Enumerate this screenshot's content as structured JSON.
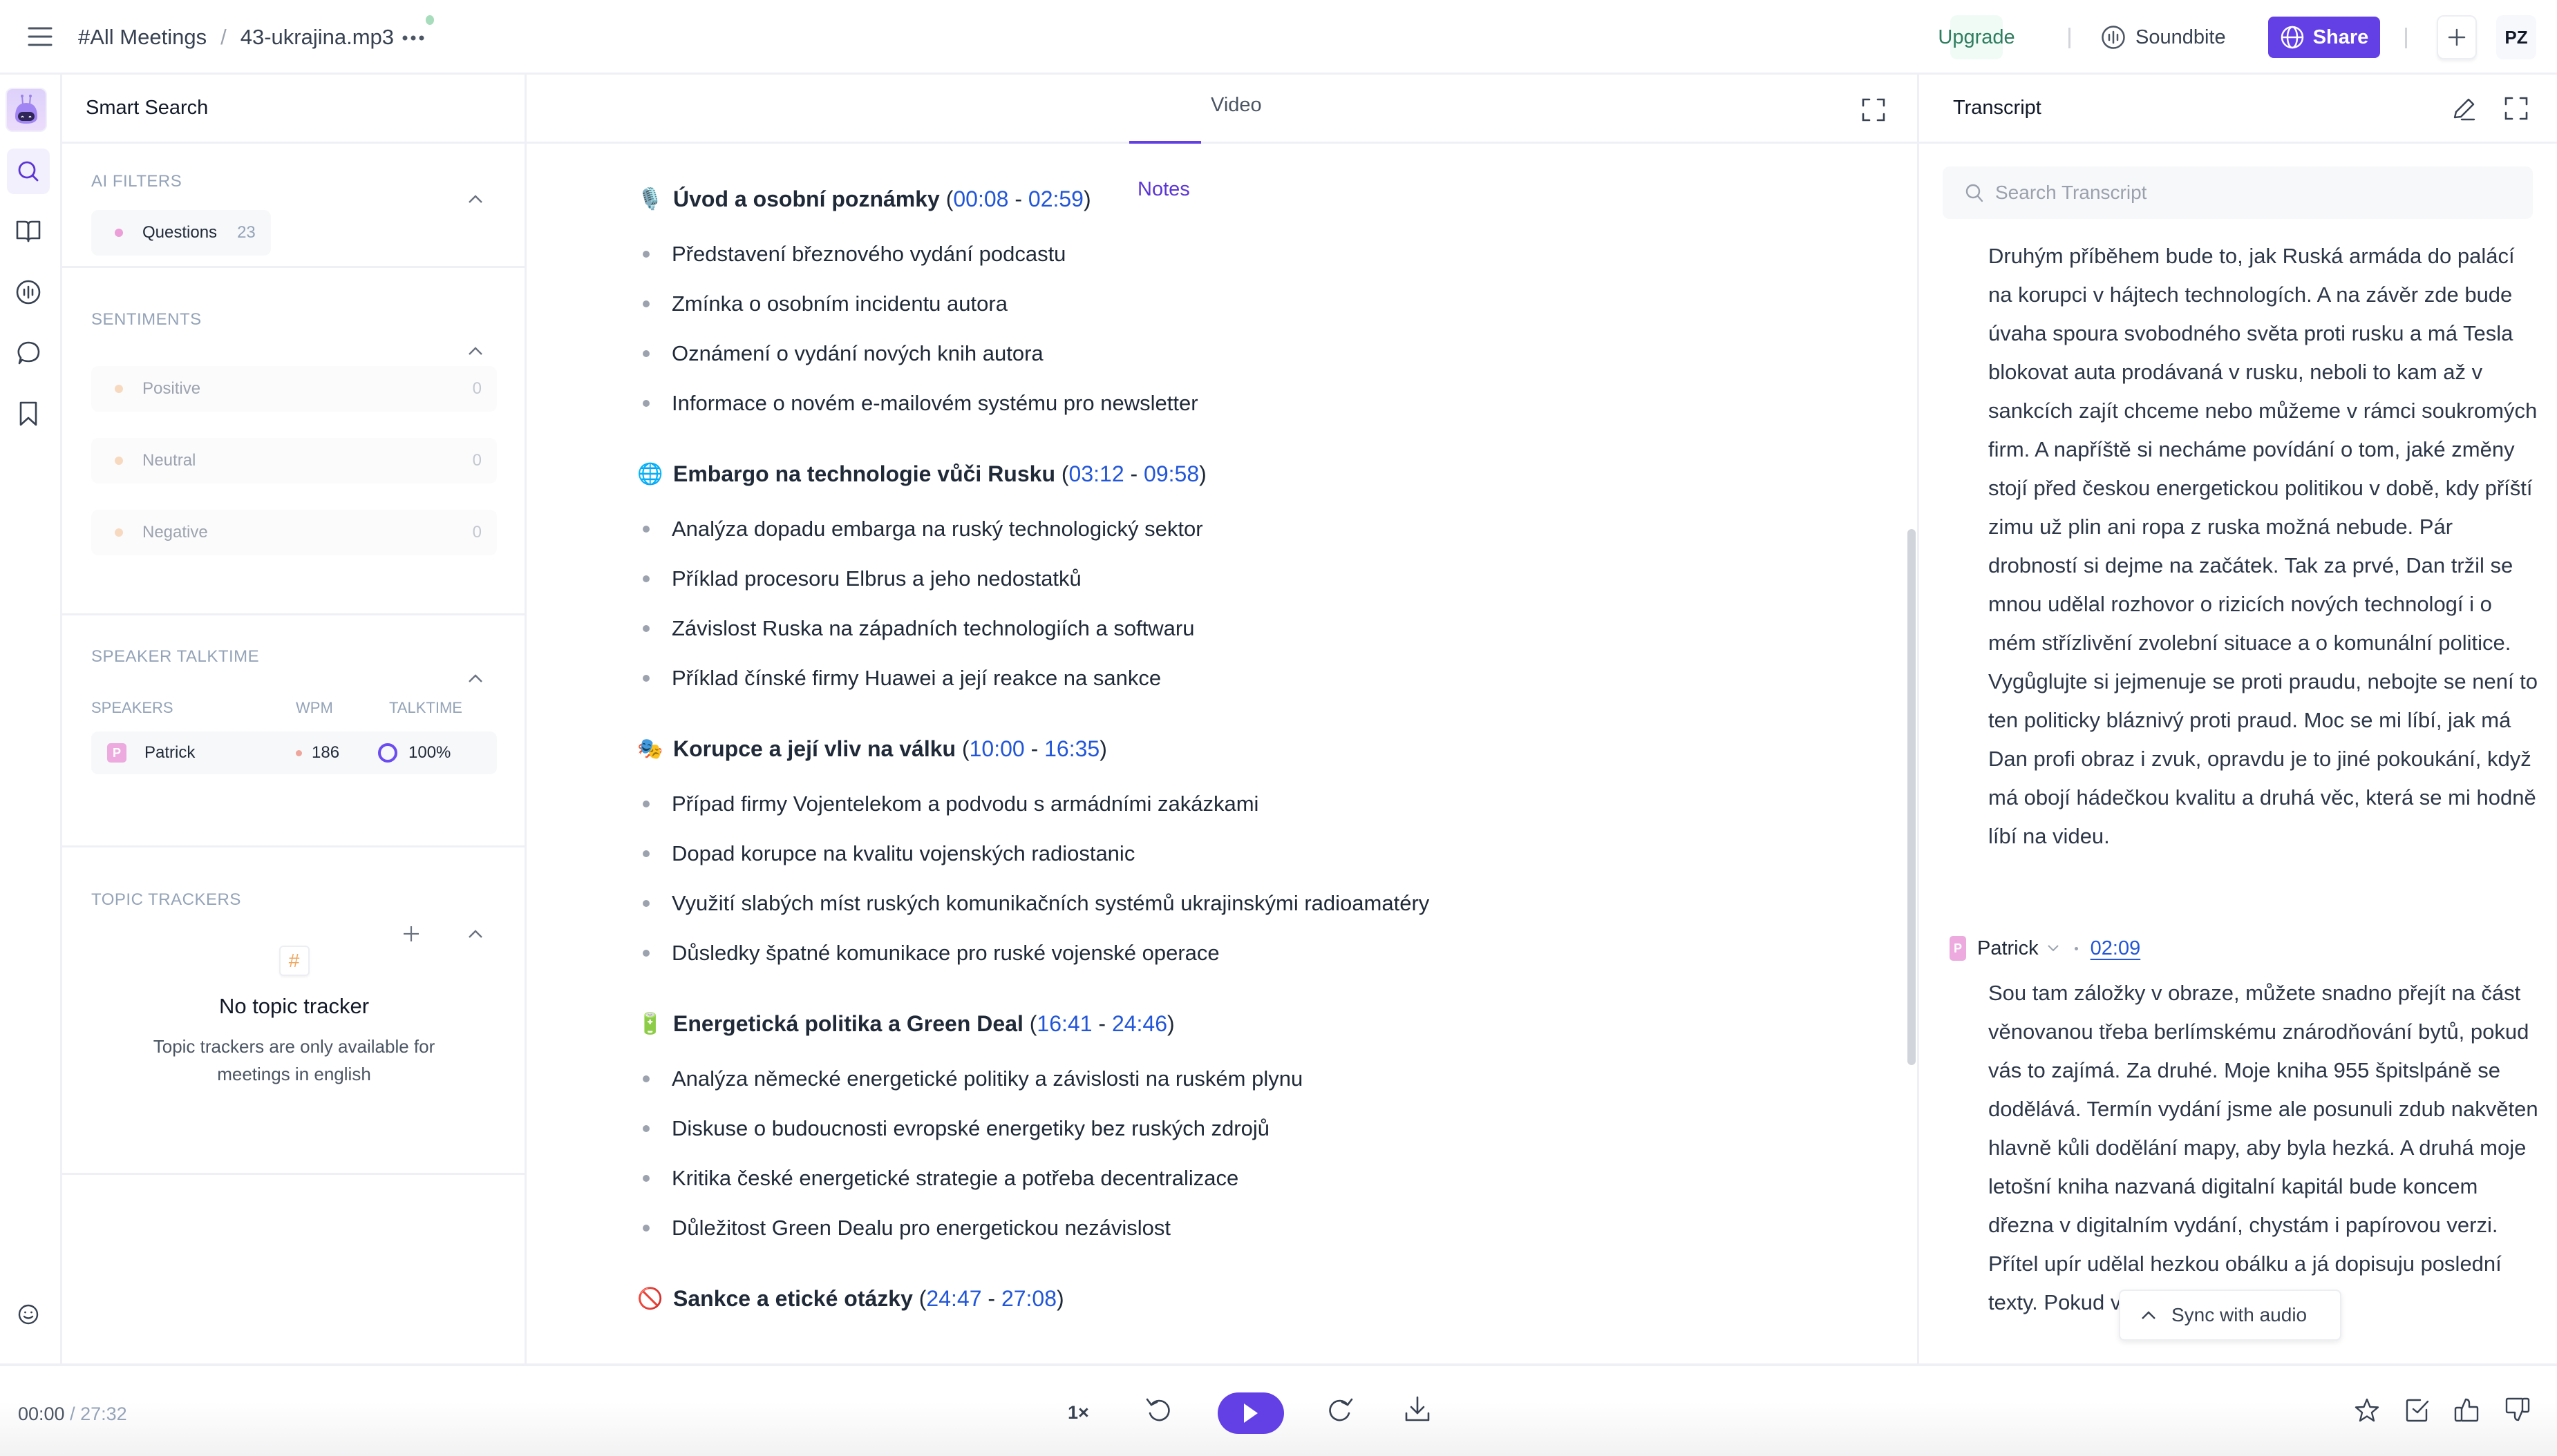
{
  "header": {
    "breadcrumb_root": "#All Meetings",
    "breadcrumb_sep": "/",
    "file_name": "43-ukrajina.mp3",
    "upgrade_label": "Upgrade",
    "soundbite_label": "Soundbite",
    "share_label": "Share",
    "user_initials": "PZ"
  },
  "rail": {
    "items": [
      "smart-search-bot",
      "search",
      "book",
      "soundwave",
      "chat",
      "bookmark"
    ],
    "footer_icon": "smiley"
  },
  "left_panel": {
    "title": "Smart Search",
    "ai_filters": {
      "title": "AI FILTERS",
      "items": [
        {
          "label": "Questions",
          "count": "23",
          "color": "#ec9ed9"
        }
      ]
    },
    "sentiments": {
      "title": "SENTIMENTS",
      "items": [
        {
          "label": "Positive",
          "count": "0"
        },
        {
          "label": "Neutral",
          "count": "0"
        },
        {
          "label": "Negative",
          "count": "0"
        }
      ]
    },
    "speaker_talktime": {
      "title": "SPEAKER TALKTIME",
      "col_speakers": "SPEAKERS",
      "col_wpm": "WPM",
      "col_talktime": "TALKTIME",
      "speakers": [
        {
          "initial": "P",
          "name": "Patrick",
          "wpm": "186",
          "talktime": "100%",
          "talktime_fraction": 1.0
        }
      ]
    },
    "topic_trackers": {
      "title": "TOPIC TRACKERS",
      "empty_icon": "#",
      "empty_title": "No topic tracker",
      "empty_text": "Topic trackers are only available for meetings in english"
    }
  },
  "center": {
    "tabs": [
      {
        "label": "Notes",
        "active": true
      },
      {
        "label": "Video",
        "active": false
      }
    ],
    "sections": [
      {
        "emoji": "🎙️",
        "title": "Úvod a osobní poznámky",
        "start": "00:08",
        "end": "02:59",
        "bullets": [
          "Představení březnového vydání podcastu",
          "Zmínka o osobním incidentu autora",
          "Oznámení o vydání nových knih autora",
          "Informace o novém e-mailovém systému pro newsletter"
        ]
      },
      {
        "emoji": "🌐",
        "title": "Embargo na technologie vůči Rusku",
        "start": "03:12",
        "end": "09:58",
        "bullets": [
          "Analýza dopadu embarga na ruský technologický sektor",
          "Příklad procesoru Elbrus a jeho nedostatků",
          "Závislost Ruska na západních technologiích a softwaru",
          "Příklad čínské firmy Huawei a její reakce na sankce"
        ]
      },
      {
        "emoji": "🎭",
        "title": "Korupce a její vliv na válku",
        "start": "10:00",
        "end": "16:35",
        "bullets": [
          "Případ firmy Vojentelekom a podvodu s armádními zakázkami",
          "Dopad korupce na kvalitu vojenských radiostanic",
          "Využití slabých míst ruských komunikačních systémů ukrajinskými radioamatéry",
          "Důsledky špatné komunikace pro ruské vojenské operace"
        ]
      },
      {
        "emoji": "🔋",
        "title": "Energetická politika a Green Deal",
        "start": "16:41",
        "end": "24:46",
        "bullets": [
          "Analýza německé energetické politiky a závislosti na ruském plynu",
          "Diskuse o budoucnosti evropské energetiky bez ruských zdrojů",
          "Kritika české energetické strategie a potřeba decentralizace",
          "Důležitost Green Dealu pro energetickou nezávislost"
        ]
      },
      {
        "emoji": "🚫",
        "title": "Sankce a etické otázky",
        "start": "24:47",
        "end": "27:08",
        "bullets": []
      }
    ]
  },
  "transcript": {
    "title": "Transcript",
    "search_placeholder": "Search Transcript",
    "para1": "Druhým příběhem bude to, jak Ruská armáda do palácí na korupci v hájtech technologích. A na závěr zde bude úvaha spoura svobodného světa proti rusku a má Tesla blokovat auta prodávaná v rusku, neboli to kam až v sankcích zajít chceme nebo můžeme v rámci soukromých firm. A napříště si necháme povídání o tom, jaké změny stojí před českou energetickou politikou v době, kdy příští zimu už plin ani ropa z ruska možná nebude. Pár drobností si dejme na začátek. Tak za prvé, Dan tržil se mnou udělal rozhovor o rizicích nových technologí i o mém střízlivění zvolební situace a o komunální politice. Vygůglujte si jejmenuje se proti praudu, nebojte se není to ten politicky bláznivý proti praud. Moc se mi líbí, jak má Dan profi obraz i zvuk, opravdu je to jiné pokoukání, když má obojí hádečkou kvalitu a druhá věc, která se mi hodně líbí na videu.",
    "speaker_initial": "P",
    "speaker_name": "Patrick",
    "speaker_ts": "02:09",
    "para2": "Sou tam záložky v obraze, můžete snadno přejít na část věnovanou třeba berlímskému znárodňování bytů, pokud vás to zajímá. Za druhé. Moje kniha 955 špitslpáně se dodělává. Termín vydání jsme ale posunuli zdub nakvěten hlavně kůli dodělání mapy, aby byla hezká. A druhá moje letošní kniha nazvaná digitalní kapitál bude koncem dřezna v digitalním vydání, chystám i papírovou verzi. Přítel upír udělal hezkou obálku a já dopisuju poslední texty. Pokud vás zajímá, jak moderní",
    "sync_label": "Sync with audio"
  },
  "player": {
    "current": "00:00",
    "sep": "/",
    "total": "27:32",
    "speed": "1×"
  },
  "colors": {
    "accent": "#6240e6",
    "link": "#2256d8",
    "upgrade_bg": "#f0fbf6",
    "upgrade_text": "#2f7d60",
    "speaker_avatar": "#ecaadf"
  }
}
